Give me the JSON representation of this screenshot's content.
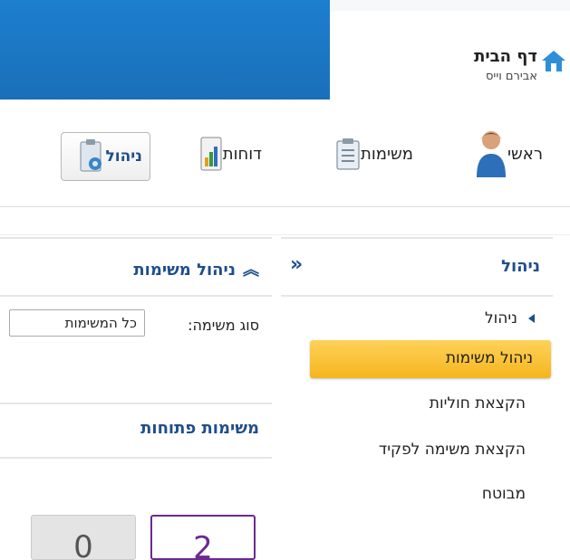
{
  "header": {
    "home_title": "דף הבית",
    "user_name": "אבירם וייס"
  },
  "nav": {
    "items": [
      {
        "label": "ראשי",
        "icon": "user-icon"
      },
      {
        "label": "משימות",
        "icon": "clipboard-icon"
      },
      {
        "label": "דוחות",
        "icon": "report-chart-icon"
      },
      {
        "label": "ניהול",
        "icon": "admin-settings-icon"
      }
    ]
  },
  "sidebar": {
    "title": "ניהול",
    "collapse_glyph": "»",
    "section": "ניהול",
    "items": [
      "ניהול משימות",
      "הקצאת חוליות",
      "הקצאת משימה לפקיד",
      "מבוטח"
    ],
    "active_item": "ניהול משימות"
  },
  "main": {
    "panel_title": "ניהול משימות",
    "task_type_label": "סוג משימה:",
    "task_type_value": "כל המשימות",
    "open_tasks_title": "משימות פתוחות",
    "counts": [
      "2",
      "0"
    ]
  },
  "colors": {
    "header_blue": "#1d7fcf",
    "accent_navy": "#1f4e8c",
    "active_orange": "#f5b51e",
    "count_purple": "#6b2a8f"
  }
}
